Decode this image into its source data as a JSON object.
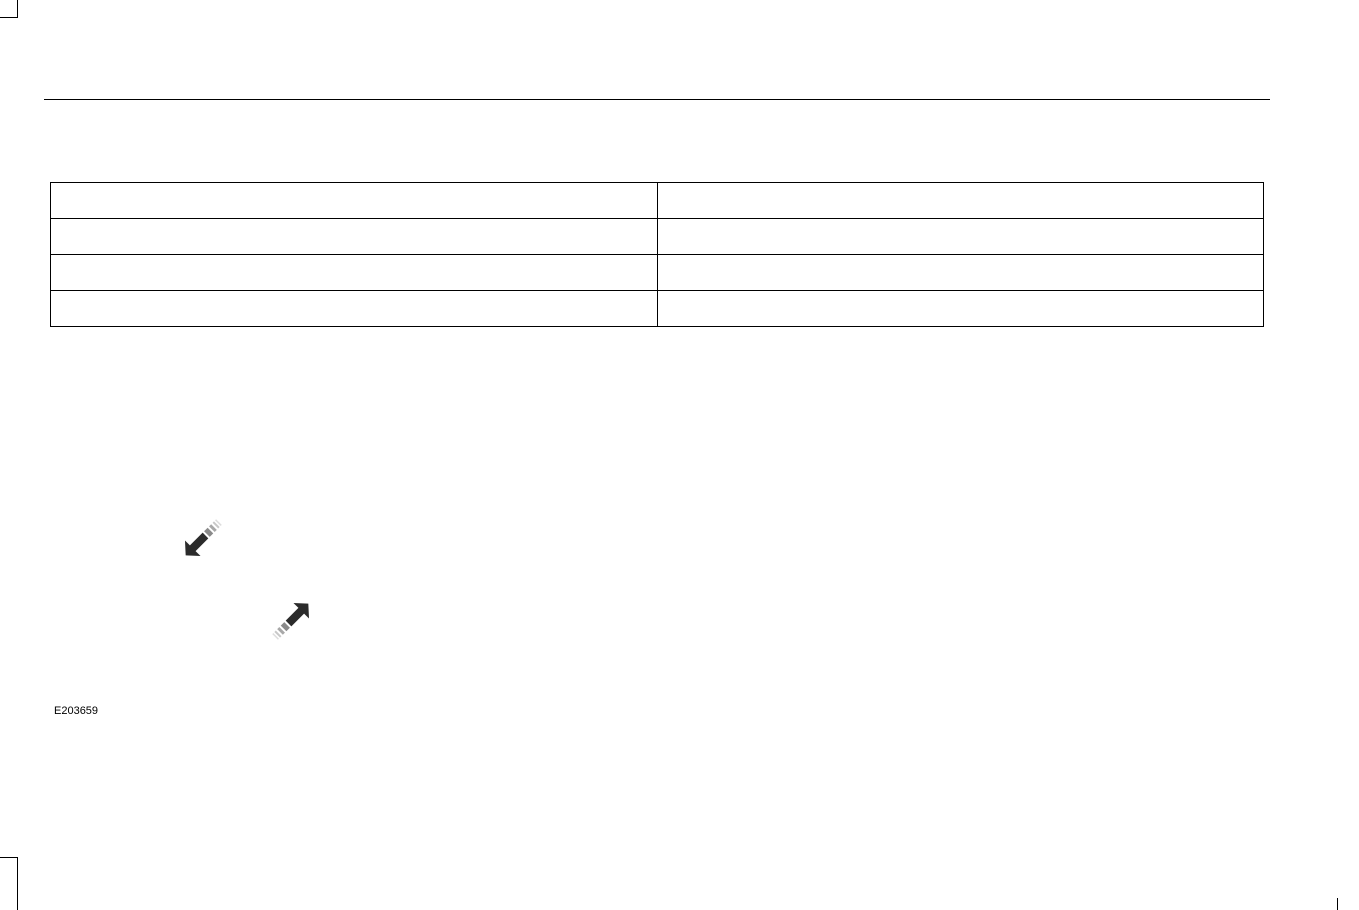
{
  "table": {
    "rows": [
      [
        "",
        ""
      ],
      [
        "",
        ""
      ],
      [
        "",
        ""
      ],
      [
        "",
        ""
      ]
    ]
  },
  "figure": {
    "code": "E203659",
    "icons": [
      "arrow-down-left-icon",
      "arrow-up-right-icon"
    ],
    "colors": {
      "arrow": "#2b2b2b",
      "stripe_dark": "#8a8a8a",
      "stripe_light": "#c8c8c8"
    }
  }
}
